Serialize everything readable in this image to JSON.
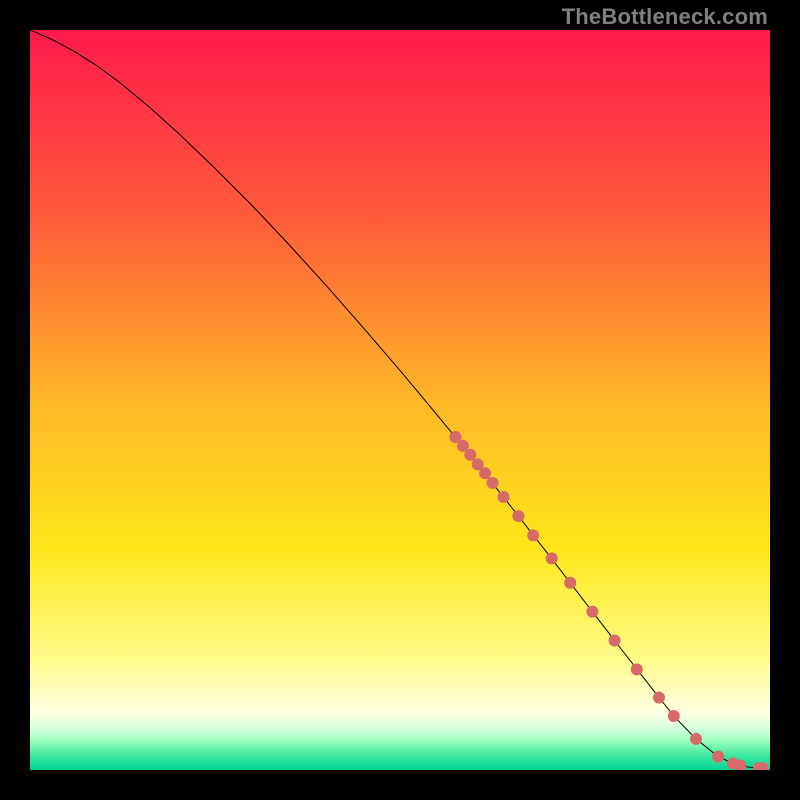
{
  "watermark": "TheBottleneck.com",
  "chart_data": {
    "type": "line",
    "title": "",
    "xlabel": "",
    "ylabel": "",
    "xlim": [
      0,
      100
    ],
    "ylim": [
      0,
      100
    ],
    "background_gradient": {
      "stops": [
        {
          "offset": 0.0,
          "color": "#ff1a4b"
        },
        {
          "offset": 0.25,
          "color": "#ff5a3a"
        },
        {
          "offset": 0.5,
          "color": "#ffb728"
        },
        {
          "offset": 0.7,
          "color": "#ffe61a"
        },
        {
          "offset": 0.85,
          "color": "#fffc8a"
        },
        {
          "offset": 0.92,
          "color": "#ffffe0"
        },
        {
          "offset": 0.94,
          "color": "#e0ffe0"
        },
        {
          "offset": 0.96,
          "color": "#a0ffc0"
        },
        {
          "offset": 0.98,
          "color": "#40e8a0"
        },
        {
          "offset": 1.0,
          "color": "#00d494"
        }
      ]
    },
    "series": [
      {
        "name": "curve",
        "type": "line",
        "x": [
          0.0,
          1.0,
          3.0,
          6.0,
          9.0,
          12.0,
          16.0,
          20.0,
          25.0,
          30.0,
          35.0,
          40.0,
          45.0,
          50.0,
          55.0,
          60.0,
          65.0,
          70.0,
          75.0,
          80.0,
          85.0,
          87.0,
          90.0,
          93.0,
          95.0,
          96.0,
          97.0,
          98.0,
          98.5,
          99.0
        ],
        "y": [
          100.0,
          99.6,
          98.7,
          97.1,
          95.2,
          93.0,
          89.7,
          86.1,
          81.3,
          76.3,
          71.0,
          65.5,
          59.8,
          54.0,
          48.0,
          41.9,
          35.6,
          29.2,
          22.7,
          16.2,
          9.8,
          7.3,
          4.2,
          1.8,
          0.9,
          0.6,
          0.4,
          0.3,
          0.25,
          0.25
        ],
        "color": "#000000",
        "width": 1.0
      },
      {
        "name": "dots",
        "type": "scatter",
        "x": [
          57.5,
          58.5,
          59.5,
          60.5,
          61.5,
          62.5,
          64.0,
          66.0,
          68.0,
          70.5,
          73.0,
          76.0,
          79.0,
          82.0,
          85.0,
          87.0,
          90.0,
          93.0,
          95.0,
          96.0,
          98.5,
          99.0
        ],
        "y": [
          45.0,
          43.8,
          42.6,
          41.3,
          40.1,
          38.8,
          36.9,
          34.3,
          31.7,
          28.6,
          25.3,
          21.4,
          17.5,
          13.6,
          9.8,
          7.3,
          4.2,
          1.8,
          0.9,
          0.6,
          0.25,
          0.25
        ],
        "color": "#d76a68",
        "radius": 6
      }
    ]
  }
}
